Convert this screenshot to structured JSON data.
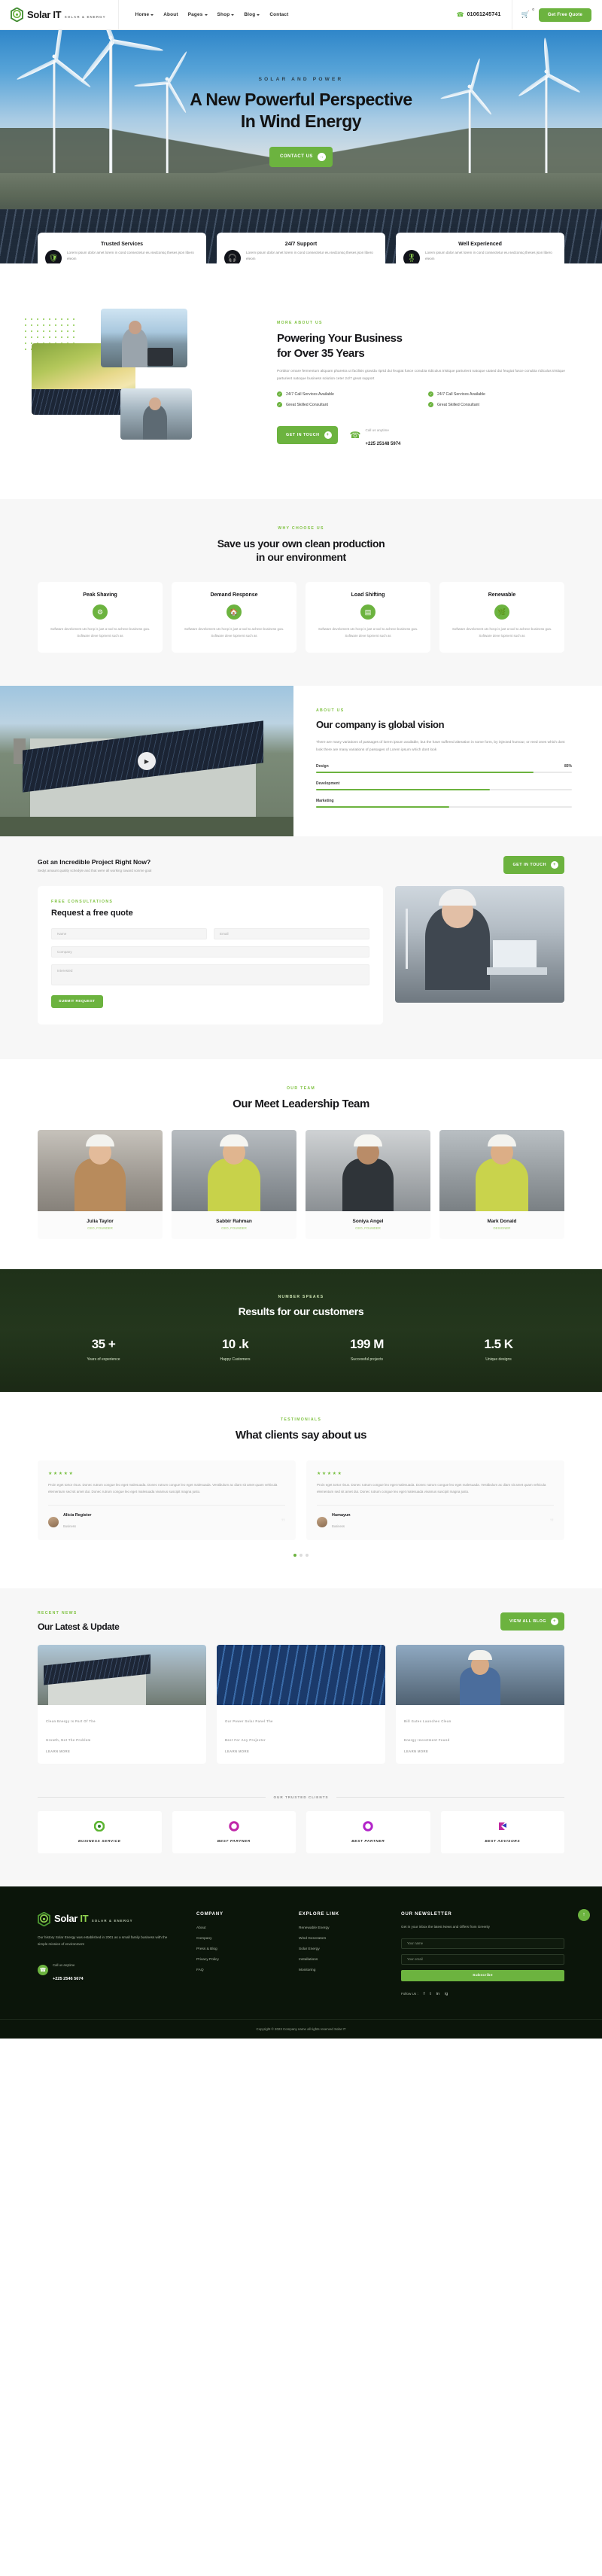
{
  "brand": {
    "name_a": "Solar",
    "name_b": "IT",
    "tagline": "SOLAR & ENERGY"
  },
  "header": {
    "nav": [
      {
        "label": "Home",
        "caret": true
      },
      {
        "label": "About",
        "caret": false
      },
      {
        "label": "Pages",
        "caret": true
      },
      {
        "label": "Shop",
        "caret": true
      },
      {
        "label": "Blog",
        "caret": true
      },
      {
        "label": "Contact",
        "caret": false
      }
    ],
    "phone": "01061245741",
    "phone_icon": "phone-icon",
    "cart_icon": "cart-icon",
    "cart_count": "0",
    "quote_button": "Get Free Quote"
  },
  "hero": {
    "kicker": "SOLAR AND POWER",
    "title_line1": "A New Powerful Perspective",
    "title_line2": "In Wind Energy",
    "button": "CONTACT US",
    "button_icon": "arrow-right-icon"
  },
  "features": [
    {
      "title": "Trusted Services",
      "text": "Lorem ipsum dolor amet lorem in cond consectetur eiu sedconsq theses json libero eleom",
      "icon": "shield-icon"
    },
    {
      "title": "24/7 Support",
      "text": "Lorem ipsum dolor amet lorem in cond consectetur eiu sedconsq theses json libero eleom",
      "icon": "headset-icon"
    },
    {
      "title": "Well Experienced",
      "text": "Lorem ipsum dolor amet lorem in cond consectetur eiu sedconsq theses json libero eleom",
      "icon": "medal-icon"
    }
  ],
  "about": {
    "kicker": "MORE ABOUT US",
    "title_line1": "Powering Your Business",
    "title_line2": "for Over 35 Years",
    "lead": "Porttitor ornare fermentum aliquam pharetra ut facilisis gravida riprtd dui feugiat fusce conubia ridiculus tristique parturient natoque utated dui feugiat fusce conubia ridiculus tristique parturient natoque business solution ceter 24/7 great support",
    "checks": [
      "24/7 Call Services Available",
      "24/7 Call Services Available",
      "Great Skilled Consultant",
      "Great Skilled Consultant"
    ],
    "button": "GET IN TOUCH",
    "call_label": "Call us anytime",
    "call_number": "+225 25148 5974"
  },
  "why": {
    "kicker": "WHY CHOOSE US",
    "title_line1": "Save us your own clean production",
    "title_line2": "in our environment",
    "cards": [
      {
        "title": "Peak Shaving",
        "icon": "wind-turbine-icon",
        "text": "Software develoment uts hcnp is just a tool to acheve business goa. Software deve lopment such as"
      },
      {
        "title": "Demand Response",
        "icon": "solar-house-icon",
        "text": "Software develoment uts hcnp is just a tool to acheve business goa. Software deve lopment such as"
      },
      {
        "title": "Load Shifting",
        "icon": "solar-panel-icon",
        "text": "Software develoment uts hcnp is just a tool to acheve business goa. Software deve lopment such as"
      },
      {
        "title": "Renewable",
        "icon": "leaf-energy-icon",
        "text": "Software develoment uts hcnp is just a tool to acheve business goa. Software deve lopment such as"
      }
    ]
  },
  "vision": {
    "kicker": "ABOUT US",
    "title": "Our company is global vision",
    "text": "There are many variations of passages of lorem ipsum available, but the have suffered alteration in some form, by injected humour, or reed ones which dont look there are many variations of passages of Lorem ipsum which dont look",
    "play_icon": "play-icon",
    "bars": [
      {
        "label": "Design",
        "value": "85%",
        "pct": 85
      },
      {
        "label": "Development",
        "value": "",
        "pct": 68
      },
      {
        "label": "Marketing",
        "value": "",
        "pct": 52
      }
    ]
  },
  "quote": {
    "heading": "Got an Incredible Project Right Now?",
    "sub": "Sedyt amaunt quality schedyle and that were all working toward sonme goal",
    "top_button": "GET IN TOUCH",
    "kicker": "FREE CONSULTATIONS",
    "title": "Request a free quote",
    "fields": {
      "name": "Name",
      "email": "Email",
      "company": "Company",
      "interested": "Interested"
    },
    "submit": "SUBMIT REQUEST"
  },
  "team": {
    "kicker": "OUR TEAM",
    "title": "Our Meet Leadership Team",
    "members": [
      {
        "name": "Julia Taylor",
        "role": "CEO, FOUNDER"
      },
      {
        "name": "Sabbir Rahman",
        "role": "CEO, FOUNDER"
      },
      {
        "name": "Soniya Angel",
        "role": "CEO, FOUNDER"
      },
      {
        "name": "Mark Donald",
        "role": "DESIGNER"
      }
    ]
  },
  "stats": {
    "kicker": "NUMBER SPEAKS",
    "title": "Results for our customers",
    "items": [
      {
        "value": "35 +",
        "label": "Years of experience"
      },
      {
        "value": "10 .k",
        "label": "Happy Customers"
      },
      {
        "value": "199 M",
        "label": "Successful projects"
      },
      {
        "value": "1.5 K",
        "label": "Unique designs"
      }
    ]
  },
  "testimonials": {
    "kicker": "TESTIMONIALS",
    "title": "What clients say about us",
    "items": [
      {
        "stars": "★★★★★",
        "text": "Proin eget tortor risus. Donec rutrum congue leo eget malesuada. Donec rutrum congue leo eget malesuada. Vestibulum ac diam sit amet quam vehicula elementum sed sit amet dui. Donec rutrum congue leo eget malesuada vivamus suscipit magna justo.",
        "name": "Alicia Register",
        "role": "Business"
      },
      {
        "stars": "★★★★★",
        "text": "Proin eget tortor risus. Donec rutrum congue leo eget malesuada. Donec rutrum congue leo eget malesuada. Vestibulum ac diam sit amet quam vehicula elementum sed sit amet dui. Donec rutrum congue leo eget malesuada vivamus suscipit magna justo.",
        "name": "Humayun",
        "role": "Business"
      }
    ],
    "dots": [
      true,
      false,
      false
    ]
  },
  "blog": {
    "kicker": "RECENT NEWS",
    "title": "Our Latest & Update",
    "button": "VIEW ALL BLOG",
    "posts": [
      {
        "title_line1": "Clean Energy Is Part Of The",
        "title_line2": "Growth, Not The Problem",
        "more": "LEARN MORE"
      },
      {
        "title_line1": "Our Power Solar Panel The",
        "title_line2": "Best For Any Projecter",
        "more": "LEARN MORE"
      },
      {
        "title_line1": "Bill Gates Launches Clean",
        "title_line2": "Energy Investment Found",
        "more": "LEARN MORE"
      }
    ]
  },
  "clients": {
    "heading": "OUR TRUSTED CLIENTS",
    "logos": [
      {
        "label": "BUSINESS SERVICE",
        "icon": "circle-target-icon"
      },
      {
        "label": "BEST PARTNER",
        "icon": "donut-icon"
      },
      {
        "label": "BEST PARTNER",
        "icon": "donut-icon"
      },
      {
        "label": "BEST ADVISORS",
        "icon": "chevron-stack-icon"
      }
    ]
  },
  "footer": {
    "about_text": "Our history Solar Energy was established in 2001 as a small family business with the simple mission of environment",
    "call_label": "Call us anytime",
    "call_number": "+225 2546 5674",
    "columns": [
      {
        "title": "COMPANY",
        "links": [
          "About",
          "Company",
          "Press & Blog",
          "Privacy Policy",
          "FAQ"
        ]
      },
      {
        "title": "EXPLORE LINK",
        "links": [
          "Renewable Energy",
          "Wind Generators",
          "Solar Energy",
          "Installations",
          "Monitoring"
        ]
      }
    ],
    "newsletter": {
      "title": "OUR NEWSLETTER",
      "text": "Get in your inbox the latest News and Offers from Greenly",
      "name_placeholder": "Your name",
      "email_placeholder": "Your email",
      "button": "Subscribe"
    },
    "follow_label": "Follow Us :",
    "socials": [
      "f",
      "t",
      "in",
      "ig"
    ],
    "copyright": "Copyright © 2023 Company name all rights reserved Solar IT",
    "totop_icon": "arrow-up-icon"
  },
  "colors": {
    "accent": "#6cb33f",
    "accent_light": "#8fd14f",
    "dark": "#0b150a",
    "stats_bg": "#20311a"
  }
}
